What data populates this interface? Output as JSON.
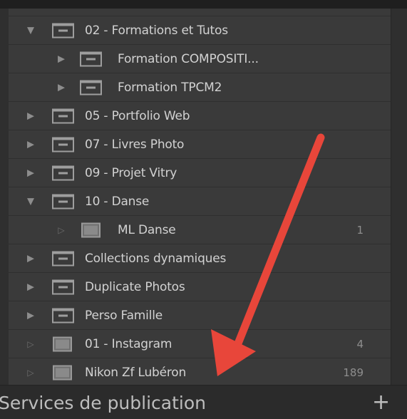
{
  "collections": [
    {
      "label": "02 - Formations et Tutos",
      "count": "",
      "expand": "open",
      "kind": "set"
    },
    {
      "label": "Formation COMPOSITI...",
      "count": "",
      "expand": "closed",
      "kind": "set"
    },
    {
      "label": "Formation TPCM2",
      "count": "",
      "expand": "closed",
      "kind": "set"
    },
    {
      "label": "05 - Portfolio Web",
      "count": "",
      "expand": "closed",
      "kind": "set"
    },
    {
      "label": "07 - Livres Photo",
      "count": "",
      "expand": "closed",
      "kind": "set"
    },
    {
      "label": "09 - Projet Vitry",
      "count": "",
      "expand": "closed",
      "kind": "set"
    },
    {
      "label": "10 - Danse",
      "count": "",
      "expand": "open",
      "kind": "set"
    },
    {
      "label": "ML Danse",
      "count": "1",
      "expand": "hollow",
      "kind": "collection"
    },
    {
      "label": "Collections dynamiques",
      "count": "",
      "expand": "closed",
      "kind": "set"
    },
    {
      "label": "Duplicate Photos",
      "count": "",
      "expand": "closed",
      "kind": "set"
    },
    {
      "label": "Perso Famille",
      "count": "",
      "expand": "closed",
      "kind": "set"
    },
    {
      "label": "01 - Instagram",
      "count": "4",
      "expand": "hollow",
      "kind": "collection"
    },
    {
      "label": "Nikon Zf Lubéron",
      "count": "189",
      "expand": "hollow",
      "kind": "collection"
    }
  ],
  "footer": {
    "title": "Services de publication",
    "add": "+"
  },
  "colors": {
    "arrow": "#e8463a"
  },
  "icons": {
    "expand_open": "triangle-down-icon",
    "expand_closed": "triangle-right-icon",
    "expand_hollow": "hollow-triangle-right-icon",
    "set": "collection-set-icon",
    "collection": "collection-icon"
  }
}
